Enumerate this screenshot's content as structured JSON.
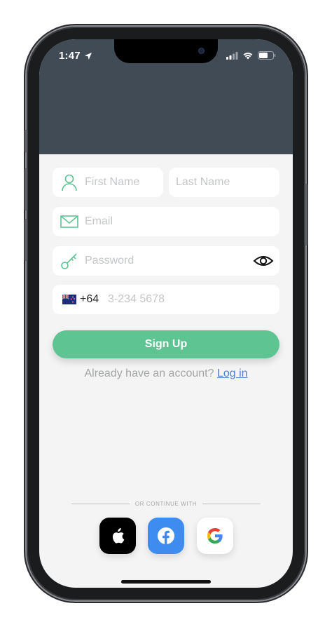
{
  "status_bar": {
    "time": "1:47",
    "icons": [
      "location-arrow-icon",
      "cellular-signal-icon",
      "wifi-icon",
      "battery-icon"
    ]
  },
  "form": {
    "first_name_placeholder": "First Name",
    "last_name_placeholder": "Last Name",
    "email_placeholder": "Email",
    "password_placeholder": "Password",
    "phone": {
      "country_flag": "new-zealand-flag",
      "dial_code": "+64",
      "placeholder": "3-234 5678"
    },
    "signup_label": "Sign Up"
  },
  "login_prompt": {
    "text": "Already have an account?",
    "link_label": "Log in"
  },
  "social": {
    "divider_text": "OR CONTINUE WITH",
    "providers": [
      "apple",
      "facebook",
      "google"
    ]
  },
  "colors": {
    "header": "#404b56",
    "accent_green": "#5ec492",
    "link_blue": "#4f7fd1",
    "facebook_blue": "#3f8cf0",
    "background": "#f4f4f4"
  }
}
